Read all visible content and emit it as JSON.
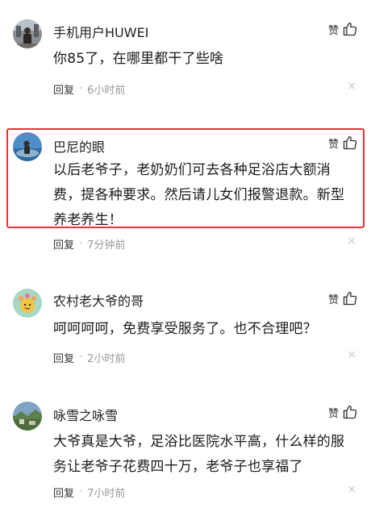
{
  "comments": [
    {
      "username": "手机用户HUWEI",
      "like_label": "赞",
      "content": "你85了，在哪里都干了些啥",
      "reply_label": "回复",
      "separator": "·",
      "time": "6小时前",
      "close_symbol": "×"
    },
    {
      "username": "巴尼的眼",
      "like_label": "赞",
      "content": "以后老爷子，老奶奶们可去各种足浴店大额消费，提各种要求。然后请儿女们报警退款。新型养老养生！",
      "reply_label": "回复",
      "separator": "·",
      "time": "7分钟前",
      "close_symbol": "×"
    },
    {
      "username": "农村老大爷的哥",
      "like_label": "赞",
      "content": "呵呵呵呵，免费享受服务了。也不合理吧？",
      "reply_label": "回复",
      "separator": "·",
      "time": "2小时前",
      "close_symbol": "×"
    },
    {
      "username": "咏雪之咏雪",
      "like_label": "赞",
      "content": "大爷真是大爷，足浴比医院水平高，什么样的服务让老爷子花费四十万，老爷子也享福了",
      "reply_label": "回复",
      "separator": "·",
      "time": "7小时前",
      "close_symbol": "×"
    }
  ],
  "colors": {
    "highlight_border": "#e8343a",
    "meta_text": "#999999"
  }
}
